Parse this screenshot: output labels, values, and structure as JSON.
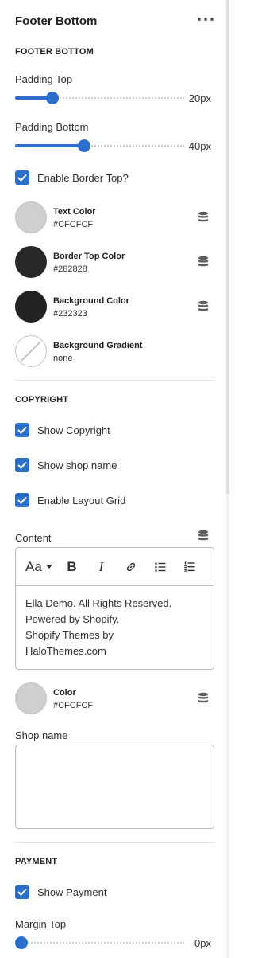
{
  "header": {
    "title": "Footer Bottom"
  },
  "footer_bottom_section": {
    "label": "FOOTER BOTTOM",
    "padding_top": {
      "label": "Padding Top",
      "value_text": "20px",
      "fraction": 0.22
    },
    "padding_bottom": {
      "label": "Padding Bottom",
      "value_text": "40px",
      "fraction": 0.41
    },
    "border_top_checkbox": {
      "label": "Enable Border Top?",
      "checked": true
    },
    "colors": [
      {
        "name": "Text Color",
        "value": "#CFCFCF",
        "swatch": "#cfcfcf"
      },
      {
        "name": "Border Top Color",
        "value": "#282828",
        "swatch": "#282828"
      },
      {
        "name": "Background Color",
        "value": "#232323",
        "swatch": "#232323"
      },
      {
        "name": "Background Gradient",
        "value": "none",
        "swatch": "none"
      }
    ]
  },
  "copyright_section": {
    "label": "COPYRIGHT",
    "checkboxes": [
      {
        "label": "Show Copyright",
        "checked": true
      },
      {
        "label": "Show shop name",
        "checked": true
      },
      {
        "label": "Enable Layout Grid",
        "checked": true
      }
    ],
    "content": {
      "label": "Content",
      "toolbar_font_label": "Aa",
      "toolbar_bold_label": "B",
      "toolbar_italic_label": "I",
      "text_lines": [
        "Ella Demo. All Rights Reserved.",
        "Powered by Shopify.",
        "Shopify Themes by",
        "HaloThemes.com"
      ]
    },
    "color": {
      "name": "Color",
      "value": "#CFCFCF",
      "swatch": "#cfcfcf"
    },
    "shop_name": {
      "label": "Shop name",
      "value": ""
    }
  },
  "payment_section": {
    "label": "PAYMENT",
    "show_payment": {
      "label": "Show Payment",
      "checked": true
    },
    "margin_top": {
      "label": "Margin Top",
      "value_text": "0px",
      "fraction": 0.0
    }
  },
  "colors": {
    "accent": "#2c6ecb",
    "divider": "#e1e3e5",
    "border": "#babfc3"
  },
  "icons": [
    "more-icon",
    "checkmark-icon",
    "database-icon",
    "caret-down-icon",
    "link-icon",
    "bullet-list-icon",
    "numbered-list-icon"
  ]
}
